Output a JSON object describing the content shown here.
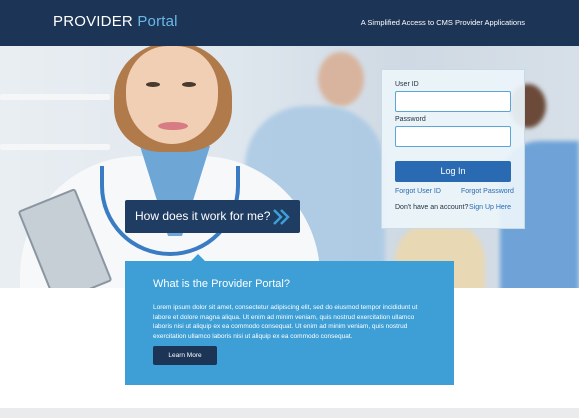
{
  "header": {
    "brand_main": "PROVIDER",
    "brand_accent": "Portal",
    "tagline": "A Simplified Access to CMS Provider Applications"
  },
  "login": {
    "user_id_label": "User ID",
    "user_id_value": "",
    "password_label": "Password",
    "password_value": "",
    "login_button": "Log In",
    "forgot_user_id": "Forgot User ID",
    "forgot_password": "Forgot Password",
    "no_account_text": "Don't have an account?",
    "sign_up_link": "Sign Up Here"
  },
  "cta": {
    "label": "How does it work for me?",
    "icon": "double-chevron-right-icon"
  },
  "info": {
    "title": "What is the Provider Portal?",
    "body": "Lorem ipsum dolor sit amet, consectetur adipiscing elit, sed do eiusmod tempor incididunt ut labore et dolore magna aliqua. Ut enim ad minim veniam, quis nostrud exercitation ullamco laboris nisi ut aliquip ex ea commodo consequat. Ut enim ad minim veniam, quis nostrud exercitation ullamco laboris nisi ut aliquip ex ea commodo consequat.",
    "button": "Learn More"
  },
  "colors": {
    "header_bg": "#1c3557",
    "brand_accent": "#6bb8e8",
    "primary_button": "#2a6ab2",
    "info_bg": "#3d9fd6",
    "cta_bg": "#1f3c63"
  }
}
